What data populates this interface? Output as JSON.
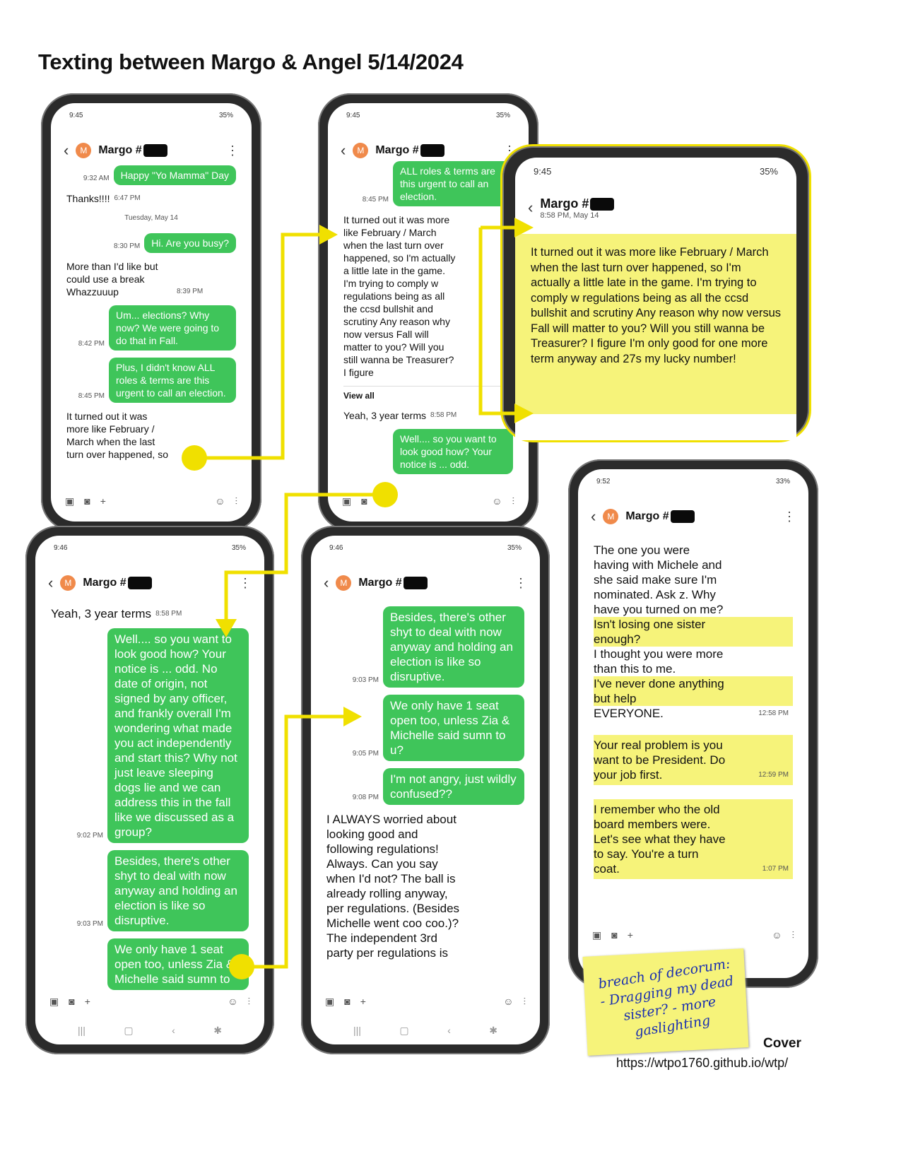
{
  "title": "Texting between Margo & Angel 5/14/2024",
  "contact": "Margo #",
  "phones": [
    {
      "status_time": "9:45",
      "battery": "35%",
      "messages": [
        {
          "dir": "out",
          "text": "Happy \"Yo Mamma\" Day",
          "time": "9:32 AM"
        },
        {
          "dir": "in",
          "text": "Thanks!!!!",
          "time": "6:47 PM"
        },
        {
          "dir": "date",
          "text": "Tuesday, May 14"
        },
        {
          "dir": "out",
          "text": "Hi. Are you busy?",
          "time": "8:30 PM"
        },
        {
          "dir": "in",
          "text": "More than I'd like but could use a break Whazzuuup",
          "time": "8:39 PM"
        },
        {
          "dir": "out",
          "text": "Um... elections? Why now? We were going to do that in Fall.",
          "time": "8:42 PM"
        },
        {
          "dir": "out",
          "text": "Plus, I didn't know ALL roles & terms are this urgent to call an election.",
          "time": "8:45 PM"
        },
        {
          "dir": "in",
          "text": "It turned out it was more like February / March when the last turn over happened, so",
          "time": ""
        }
      ]
    },
    {
      "status_time": "9:45",
      "battery": "35%",
      "messages": [
        {
          "dir": "out",
          "text": "ALL roles & terms are this urgent to call an election.",
          "time": "8:45 PM"
        },
        {
          "dir": "in",
          "text": "It turned out it was more like February / March when the last turn over happened, so I'm actually a little late in the game. I'm trying to comply w regulations being as all the ccsd bullshit and scrutiny Any reason why now versus Fall will matter to you? Will you still wanna be Treasurer? I figure",
          "time": ""
        },
        {
          "dir": "link",
          "text": "View all",
          "time": ""
        },
        {
          "dir": "in",
          "text": "Yeah, 3 year terms",
          "time": "8:58 PM"
        },
        {
          "dir": "out",
          "text": "Well.... so you want to look good how? Your notice is ... odd.",
          "time": ""
        }
      ]
    },
    {
      "status_time": "9:45",
      "battery": "35%",
      "subtitle": "8:58 PM, May 14",
      "text": "It turned out it was more like February / March when the last turn over happened, so I'm actually a little late in the game. I'm trying to comply w regulations being as all the ccsd bullshit and scrutiny Any reason why now versus Fall will matter to you? Will you still wanna be Treasurer? I figure I'm only good for one more term anyway and 27s my lucky number!"
    },
    {
      "status_time": "9:46",
      "battery": "35%",
      "messages": [
        {
          "dir": "in",
          "text": "Yeah, 3 year terms",
          "time": "8:58 PM"
        },
        {
          "dir": "out",
          "text": "Well.... so you want to look good how? Your notice is ... odd. No date of origin, not signed by any officer, and frankly overall I'm wondering what made you act independently and start this? Why not just leave sleeping dogs lie and we can address this in the fall like we discussed as a group?",
          "time": "9:02 PM"
        },
        {
          "dir": "out",
          "text": "Besides, there's other shyt to deal with now anyway and holding an election is like so disruptive.",
          "time": "9:03 PM"
        },
        {
          "dir": "out",
          "text": "We only have 1 seat open too, unless Zia & Michelle said sumn to",
          "time": ""
        }
      ]
    },
    {
      "status_time": "9:46",
      "battery": "35%",
      "messages": [
        {
          "dir": "out",
          "text": "Besides, there's other shyt to deal with now anyway and holding an election is like so disruptive.",
          "time": "9:03 PM"
        },
        {
          "dir": "out",
          "text": "We only have 1 seat open too, unless Zia & Michelle said sumn to u?",
          "time": "9:05 PM"
        },
        {
          "dir": "out",
          "text": "I'm not angry, just wildly confused??",
          "time": "9:08 PM"
        },
        {
          "dir": "in",
          "text": "I ALWAYS worried about looking good and following regulations! Always. Can you say when I'd not? The ball is already rolling anyway, per regulations. (Besides Michelle went coo coo.)? The independent 3rd party per regulations is",
          "time": ""
        }
      ]
    },
    {
      "status_time": "9:52",
      "battery": "33%",
      "lines": [
        {
          "text": "The one you were having with Michele and she said make sure I'm nominated. Ask z. Why have you turned on me?",
          "hl": false
        },
        {
          "text": "Isn't losing one sister enough?",
          "hl": true
        },
        {
          "text": "I thought you were more than this to me.",
          "hl": false
        },
        {
          "text": "I've never done anything but help",
          "hl": true
        },
        {
          "text": "EVERYONE.",
          "hl": false,
          "time": "12:58 PM"
        },
        {
          "text": "Your real problem is you want to be President. Do your job first.",
          "hl": true,
          "time": "12:59 PM"
        },
        {
          "text": "I remember who the old board members were. Let's see what they have to say. You're a turn coat.",
          "hl": true,
          "time": "1:07 PM"
        }
      ]
    }
  ],
  "note": "breach of decorum: - Dragging my dead sister? - more gaslighting",
  "cover_label": "Cover",
  "url": "https://wtpo1760.github.io/wtp/"
}
